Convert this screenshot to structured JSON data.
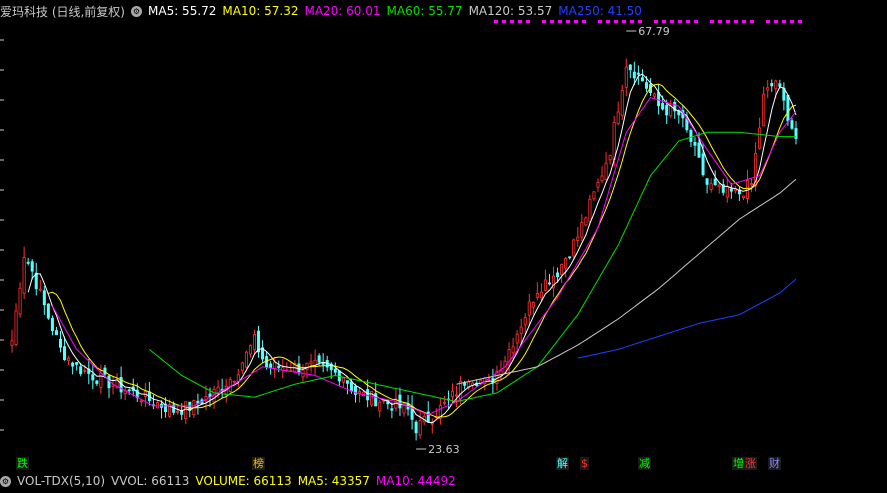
{
  "header": {
    "stock_title": "爱玛科技 (日线,前复权)",
    "ma5": "MA5: 55.72",
    "ma10": "MA10: 57.32",
    "ma20": "MA20: 60.01",
    "ma60": "MA60: 55.77",
    "ma120": "MA120: 53.57",
    "ma250": "MA250: 41.50"
  },
  "volume_header": {
    "indicator": "VOL-TDX(5,10)",
    "vvol": "VVOL: 66113",
    "volume": "VOLUME: 66113",
    "ma5": "MA5: 43357",
    "ma10": "MA10: 44492"
  },
  "colors": {
    "up": "#ff3232",
    "down": "#54ffff",
    "ma5": "#ffffff",
    "ma10": "#ffff00",
    "ma20": "#ff00ff",
    "ma60": "#00e000",
    "ma120": "#c8c8c8",
    "ma250": "#2040ff",
    "header_text": "#c8c8c8"
  },
  "event_tags": [
    {
      "label": "跌",
      "color": "#00ff00"
    },
    {
      "label": "榜",
      "color": "#ffbb00"
    },
    {
      "label": "解",
      "color": "#54ffff"
    },
    {
      "label": "$",
      "color": "#ff3232"
    },
    {
      "label": "减",
      "color": "#00ff00"
    },
    {
      "label": "增",
      "color": "#00ff00"
    },
    {
      "label": "涨",
      "color": "#ff3232"
    },
    {
      "label": "财",
      "color": "#8888ff"
    }
  ],
  "chart_data": {
    "type": "candlestick",
    "title": "爱玛科技 (日线,前复权)",
    "price_labels": {
      "high": "67.79",
      "low": "23.63"
    },
    "ylim": [
      22,
      70
    ],
    "n_bars": 195,
    "close_anchors": [
      [
        0,
        34
      ],
      [
        3,
        44
      ],
      [
        5,
        42
      ],
      [
        8,
        38
      ],
      [
        12,
        33
      ],
      [
        16,
        31
      ],
      [
        20,
        30
      ],
      [
        25,
        29
      ],
      [
        30,
        28
      ],
      [
        35,
        27
      ],
      [
        40,
        26
      ],
      [
        45,
        26.5
      ],
      [
        50,
        28
      ],
      [
        55,
        30
      ],
      [
        60,
        34
      ],
      [
        63,
        31
      ],
      [
        68,
        31
      ],
      [
        75,
        31
      ],
      [
        82,
        30
      ],
      [
        85,
        28
      ],
      [
        92,
        27
      ],
      [
        98,
        26
      ],
      [
        100,
        24
      ],
      [
        103,
        25
      ],
      [
        108,
        27
      ],
      [
        113,
        30
      ],
      [
        118,
        29
      ],
      [
        122,
        32
      ],
      [
        127,
        37
      ],
      [
        130,
        40
      ],
      [
        135,
        42
      ],
      [
        140,
        46
      ],
      [
        145,
        52
      ],
      [
        148,
        56
      ],
      [
        152,
        66
      ],
      [
        156,
        64
      ],
      [
        160,
        61
      ],
      [
        165,
        60
      ],
      [
        168,
        57
      ],
      [
        172,
        52
      ],
      [
        176,
        51
      ],
      [
        180,
        51
      ],
      [
        183,
        52
      ],
      [
        186,
        62
      ],
      [
        189,
        64
      ],
      [
        192,
        60
      ],
      [
        195,
        56
      ]
    ],
    "ma_lines": [
      {
        "name": "MA20",
        "anchors": [
          [
            10,
            38
          ],
          [
            16,
            33
          ],
          [
            25,
            29
          ],
          [
            35,
            26.5
          ],
          [
            45,
            26.5
          ],
          [
            55,
            29
          ],
          [
            62,
            31
          ],
          [
            75,
            30
          ],
          [
            85,
            28
          ],
          [
            95,
            27
          ],
          [
            103,
            25.5
          ],
          [
            110,
            27
          ],
          [
            122,
            31
          ],
          [
            135,
            39
          ],
          [
            145,
            47
          ],
          [
            152,
            58
          ],
          [
            158,
            62
          ],
          [
            165,
            61
          ],
          [
            172,
            56
          ],
          [
            178,
            52
          ],
          [
            185,
            53
          ],
          [
            190,
            58
          ],
          [
            195,
            61
          ]
        ]
      },
      {
        "name": "MA60",
        "anchors": [
          [
            34,
            33
          ],
          [
            42,
            30
          ],
          [
            50,
            28
          ],
          [
            60,
            27.5
          ],
          [
            70,
            29
          ],
          [
            80,
            30
          ],
          [
            90,
            29
          ],
          [
            100,
            28
          ],
          [
            110,
            27
          ],
          [
            120,
            28
          ],
          [
            130,
            31
          ],
          [
            140,
            37
          ],
          [
            150,
            45
          ],
          [
            158,
            53
          ],
          [
            165,
            57
          ],
          [
            172,
            58
          ],
          [
            180,
            58
          ],
          [
            190,
            57.5
          ],
          [
            195,
            57.5
          ]
        ]
      },
      {
        "name": "MA120",
        "anchors": [
          [
            110,
            29
          ],
          [
            120,
            30
          ],
          [
            130,
            31
          ],
          [
            140,
            33.5
          ],
          [
            150,
            36.5
          ],
          [
            160,
            40
          ],
          [
            170,
            44
          ],
          [
            180,
            48
          ],
          [
            190,
            51
          ],
          [
            195,
            53
          ]
        ]
      },
      {
        "name": "MA250",
        "anchors": [
          [
            140,
            32
          ],
          [
            150,
            33
          ],
          [
            160,
            34.5
          ],
          [
            170,
            36
          ],
          [
            180,
            37
          ],
          [
            190,
            39.5
          ],
          [
            195,
            41.5
          ]
        ]
      }
    ],
    "grid": false
  }
}
